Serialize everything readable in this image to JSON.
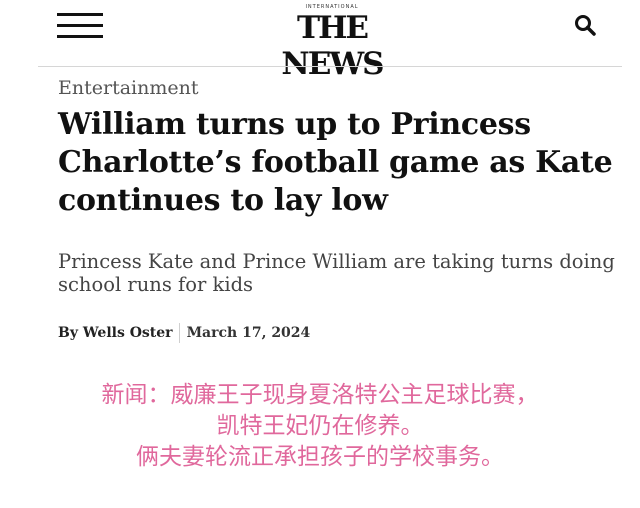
{
  "header": {
    "logo_top": "INTERNATIONAL",
    "logo_text": "THE NEWS",
    "menu_icon": "hamburger-menu-icon",
    "search_icon": "search-icon"
  },
  "article": {
    "category": "Entertainment",
    "headline": "William turns up to Princess Charlotte’s football game as Kate continues to lay low",
    "subheadline": "Princess Kate and Prince William are taking turns doing school runs for kids",
    "author": "By Wells Oster",
    "date": "March 17, 2024"
  },
  "caption": {
    "lines": [
      "新闻：威廉王子现身夏洛特公主足球比赛，",
      "凯特王妃仍在修养。",
      "俩夫妻轮流正承担孩子的学校事务。"
    ]
  },
  "colors": {
    "caption": "#e0689c",
    "text": "#111111",
    "muted": "#555555"
  }
}
